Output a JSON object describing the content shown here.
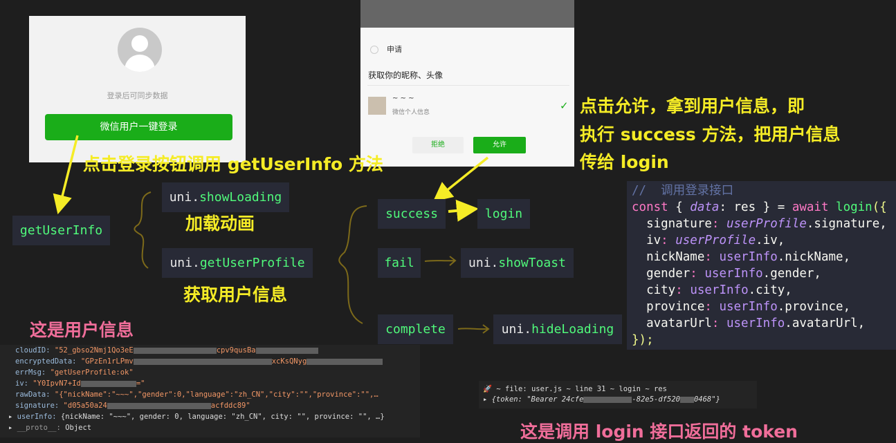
{
  "login_panel": {
    "hint": "登录后可同步数据",
    "button": "微信用户一键登录"
  },
  "auth_dialog": {
    "apply": "申请",
    "desc": "获取你的昵称、头像",
    "nickname": "~ ~ ~",
    "subtitle": "微信个人信息",
    "reject": "拒绝",
    "allow": "允许"
  },
  "annotations": {
    "click_login": "点击登录按钮调用 getUserInfo 方法",
    "click_allow": [
      "点击允许，拿到用户信息，即",
      "执行 success 方法，把用户信息",
      "传给 login"
    ],
    "loading": "加载动画",
    "get_profile": "获取用户信息",
    "user_info": "这是用户信息",
    "token": "这是调用 login 接口返回的 token"
  },
  "flow": {
    "getUserInfo": "getUserInfo",
    "showLoading_prefix": "uni.",
    "showLoading": "showLoading",
    "getUserProfile_prefix": "uni.",
    "getUserProfile": "getUserProfile",
    "success": "success",
    "login": "login",
    "fail": "fail",
    "showToast_prefix": "uni.",
    "showToast": "showToast",
    "complete": "complete",
    "hideLoading_prefix": "uni.",
    "hideLoading": "hideLoading"
  },
  "code": {
    "comment": "//  调用登录接口",
    "l2_const": "const",
    "l2_a": " { ",
    "l2_data": "data",
    "l2_b": ": res } = ",
    "l2_await": "await",
    "l2_login": " login",
    "l2_c": "({",
    "fields": [
      {
        "key": "signature",
        "obj": "userProfile",
        "prop": ".signature,"
      },
      {
        "key": "iv",
        "obj": "userProfile",
        "prop": ".iv,"
      },
      {
        "key": "nickName",
        "obj": "userInfo",
        "prop": ".nickName,"
      },
      {
        "key": "gender",
        "obj": "userInfo",
        "prop": ".gender,"
      },
      {
        "key": "city",
        "obj": "userInfo",
        "prop": ".city,"
      },
      {
        "key": "province",
        "obj": "userInfo",
        "prop": ".province,"
      },
      {
        "key": "avatarUrl",
        "obj": "userInfo",
        "prop": ".avatarUrl,"
      }
    ],
    "close": "});"
  },
  "console": {
    "cloudID_key": "cloudID:",
    "cloudID_a": "\"52_gbso2Nmj1Qo3eE",
    "cloudID_b": "cpv9qusBa",
    "enc_key": "encryptedData:",
    "enc_a": "\"GPzEn1rLPmv",
    "enc_b": "xcKsQNyg",
    "err_key": "errMsg:",
    "err_val": "\"getUserProfile:ok\"",
    "iv_key": "iv:",
    "iv_a": "\"Y0IpvN7+Id",
    "iv_b": "=\"",
    "raw_key": "rawData:",
    "raw_val": "\"{\"nickName\":\"~~~\",\"gender\":0,\"language\":\"zh_CN\",\"city\":\"\",\"province\":\"\",…",
    "sig_key": "signature:",
    "sig_a": "\"d05a50a24",
    "sig_b": "acfddc89\"",
    "ui_key": "userInfo:",
    "ui_val": "{nickName: \"~~~\", gender: 0, language: \"zh_CN\", city: \"\", province: \"\", …}",
    "proto_key": "__proto__:",
    "proto_val": "Object"
  },
  "console2": {
    "line1": "🚀 ~ file: user.js ~ line 31 ~ login ~ res",
    "line2_a": "{token: \"Bearer 24cfe",
    "line2_b": "-82e5-df520",
    "line2_c": "0468\"}"
  }
}
